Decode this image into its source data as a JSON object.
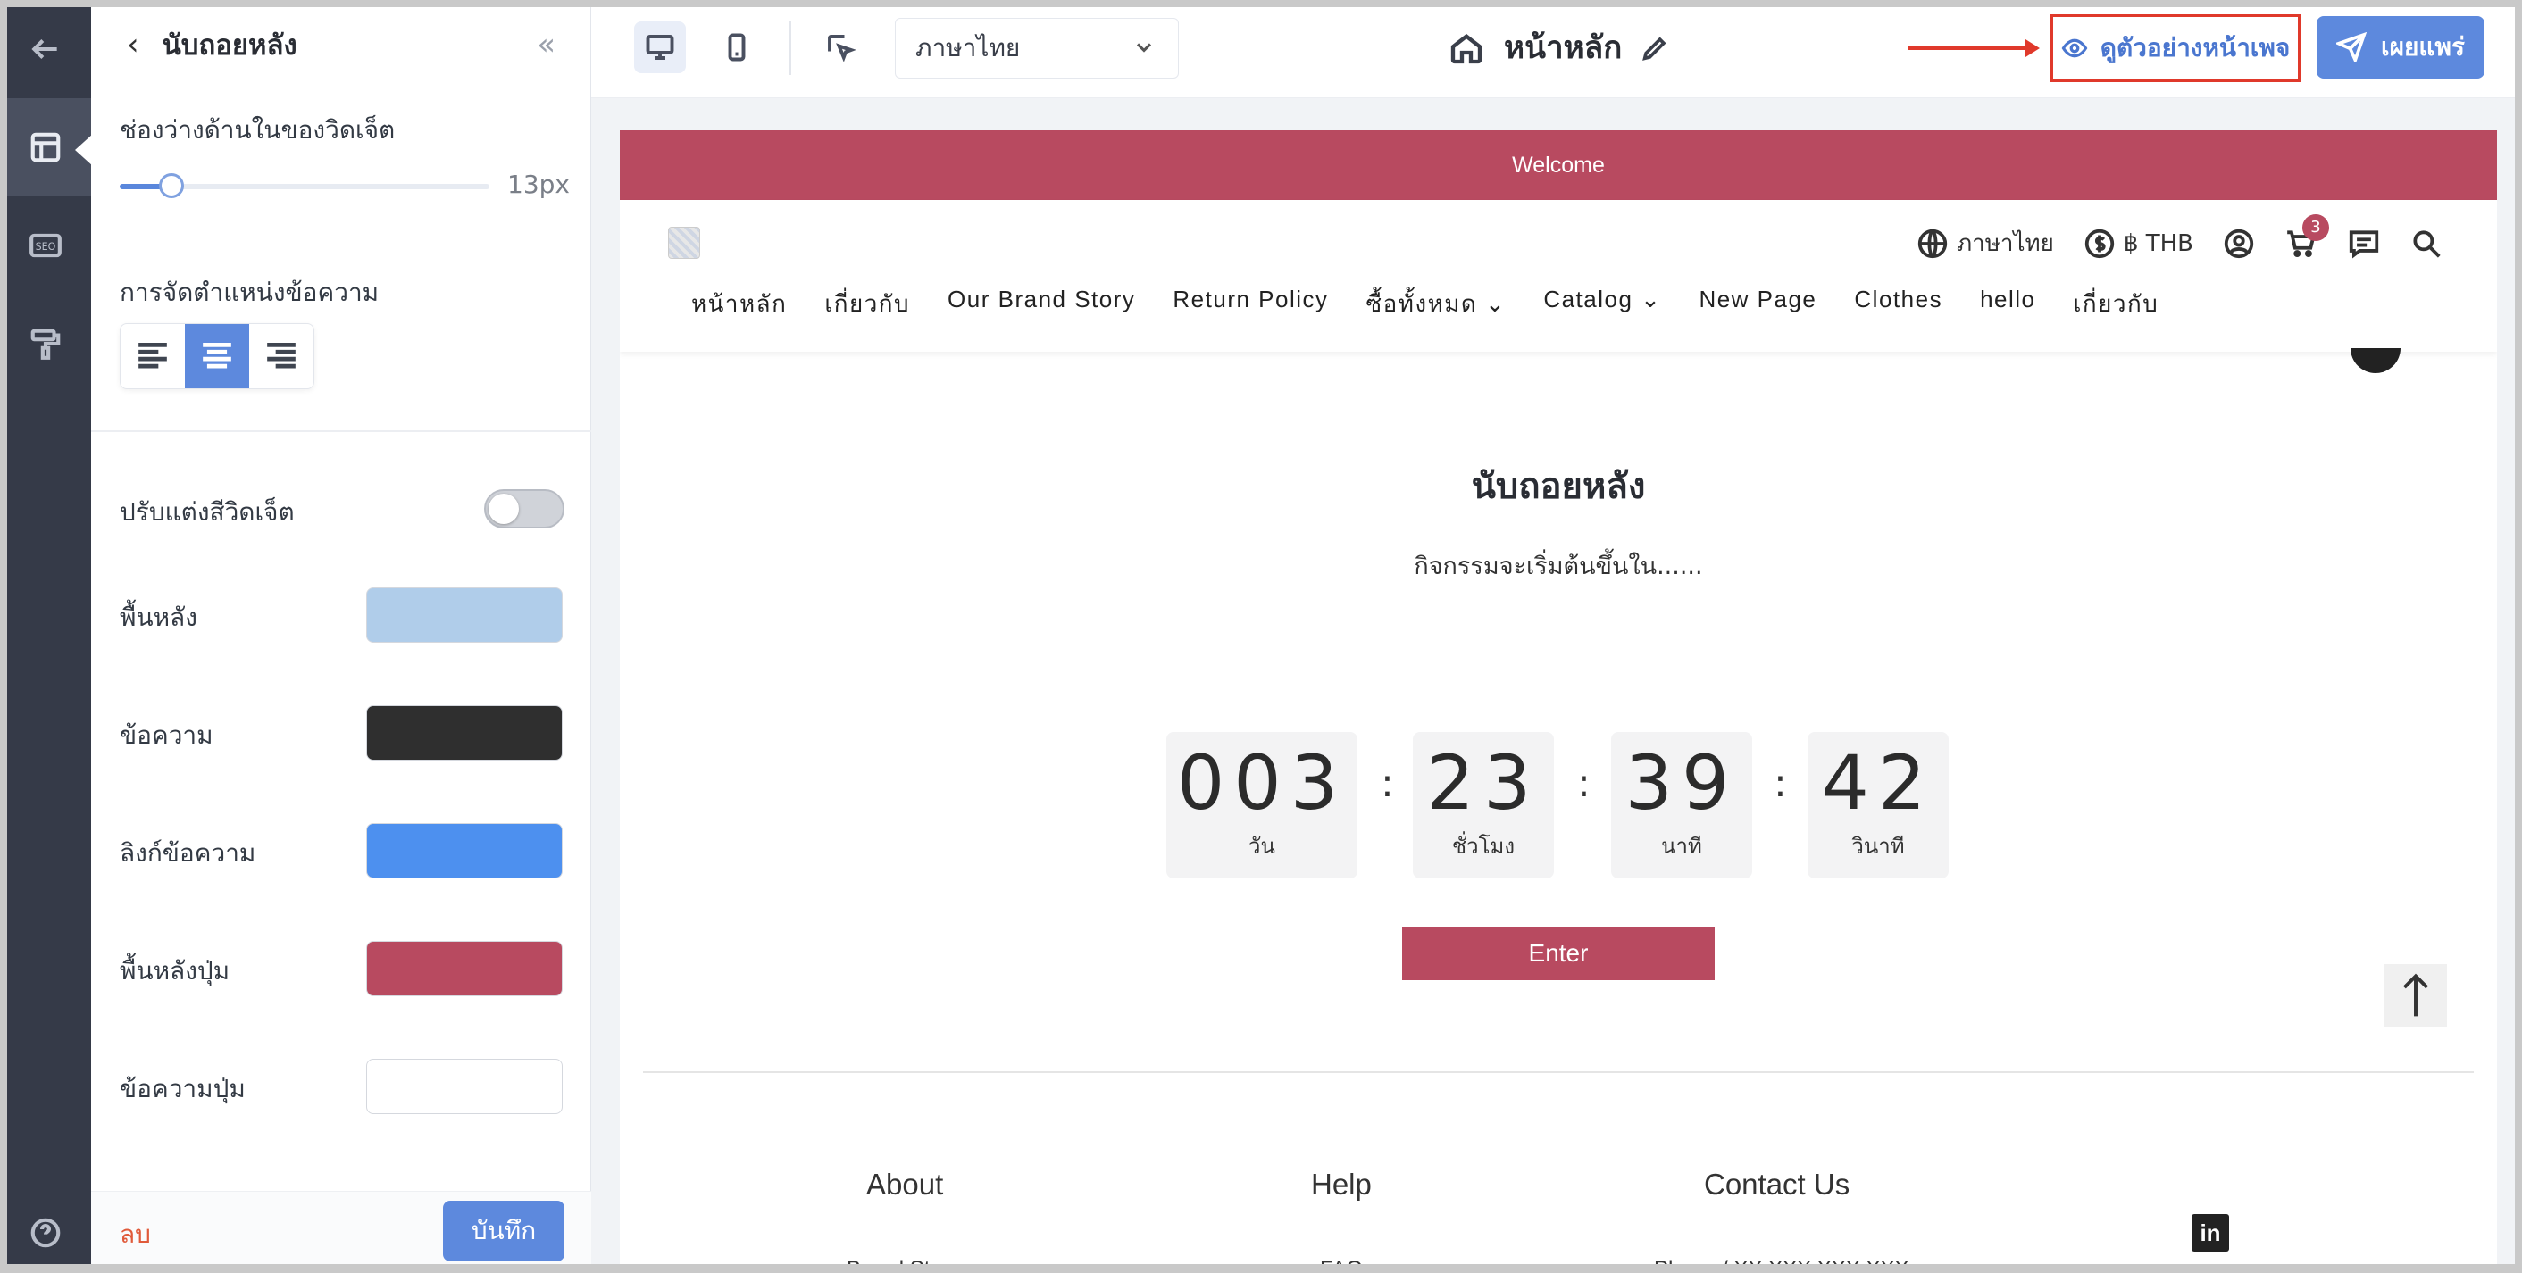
{
  "editor": {
    "panel_title": "นับถอยหลัง",
    "padding_label": "ช่องว่างด้านในของวิดเจ็ต",
    "padding_value": "13px",
    "padding_fraction": 0.14,
    "text_align_label": "การจัดตำแหน่งข้อความ",
    "text_align_selected": "center",
    "custom_color_label": "ปรับแต่งสีวิดเจ็ต",
    "custom_color_enabled": false,
    "colors": [
      {
        "label": "พื้นหลัง",
        "value": "#b0cdea"
      },
      {
        "label": "ข้อความ",
        "value": "#2f2f2f"
      },
      {
        "label": "ลิงก์ข้อความ",
        "value": "#4d90ef"
      },
      {
        "label": "พื้นหลังปุ่ม",
        "value": "#b84a60"
      },
      {
        "label": "ข้อความปุ่ม",
        "value": "#ffffff"
      }
    ],
    "delete_label": "ลบ",
    "save_label": "บันทึก"
  },
  "topbar": {
    "language": "ภาษาไทย",
    "page_name": "หน้าหลัก",
    "preview_label": "ดูตัวอย่างหน้าเพจ",
    "publish_label": "เผยแพร่"
  },
  "site": {
    "announcement": "Welcome",
    "header": {
      "language": "ภาษาไทย",
      "currency": "฿ THB",
      "cart_count": "3"
    },
    "nav": [
      "หน้าหลัก",
      "เกี่ยวกับ",
      "Our Brand Story",
      "Return Policy",
      "ซื้อทั้งหมด ⌄",
      "Catalog ⌄",
      "New Page",
      "Clothes",
      "hello",
      "เกี่ยวกับ"
    ],
    "countdown": {
      "title": "นับถอยหลัง",
      "subtitle": "กิจกรรมจะเริ่มต้นขึ้นใน......",
      "units": [
        {
          "value": "003",
          "label": "วัน"
        },
        {
          "value": "23",
          "label": "ชั่วโมง"
        },
        {
          "value": "39",
          "label": "นาที"
        },
        {
          "value": "42",
          "label": "วินาที"
        }
      ],
      "button": "Enter"
    },
    "footer": {
      "headings": [
        "About",
        "Help",
        "Contact Us"
      ],
      "links": [
        "Brand Story",
        "FAQ",
        "Phone / XX XXX XXX XXX"
      ],
      "social": "in"
    }
  },
  "colors": {
    "accent": "#5d89dd",
    "brand": "#b84a60",
    "annotation": "#e0392b"
  }
}
